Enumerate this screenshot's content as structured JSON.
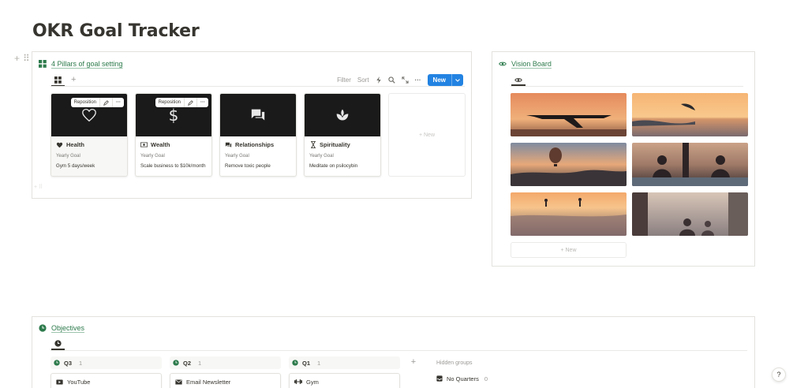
{
  "page": {
    "title": "OKR Goal Tracker"
  },
  "pillars": {
    "title": "4 Pillars of goal setting",
    "toolbar": {
      "filter": "Filter",
      "sort": "Sort",
      "new": "New"
    },
    "cards": [
      {
        "name": "Health",
        "prop_label": "Yearly Goal",
        "value": "Gym 5 days/week",
        "icon": "heart-pulse-icon",
        "cover_icon": "heart-icon"
      },
      {
        "name": "Wealth",
        "prop_label": "Yearly Goal",
        "value": "Scale business to $10k/month",
        "icon": "money-icon",
        "cover_icon": "dollar-icon"
      },
      {
        "name": "Relationships",
        "prop_label": "Yearly Goal",
        "value": "Remove toxic people",
        "icon": "chat-bubbles-icon",
        "cover_icon": "chat-icon"
      },
      {
        "name": "Spirituality",
        "prop_label": "Yearly Goal",
        "value": "Meditate on psilocybin",
        "icon": "hourglass-icon",
        "cover_icon": "lotus-icon"
      }
    ],
    "hover_tools": {
      "reposition": "Reposition"
    },
    "new_card": "+ New"
  },
  "vision": {
    "title": "Vision Board",
    "new_card": "+ New",
    "photos": [
      "airplane-sunset",
      "dolphin-jump",
      "hot-air-balloon",
      "meditation-pool",
      "sea-sunset-swimmers",
      "balcony-view"
    ]
  },
  "objectives": {
    "title": "Objectives",
    "columns": [
      {
        "name": "Q3",
        "count": "1",
        "card": "YouTube",
        "card_icon": "video-icon"
      },
      {
        "name": "Q2",
        "count": "1",
        "card": "Email Newsletter",
        "card_icon": "mail-icon"
      },
      {
        "name": "Q1",
        "count": "1",
        "card": "Gym",
        "card_icon": "dumbbell-icon"
      }
    ],
    "hidden_groups": {
      "title": "Hidden groups",
      "item": "No Quarters",
      "count": "0"
    }
  },
  "help": {
    "label": "?"
  },
  "colors": {
    "accent_green": "#2c7a4b",
    "primary_blue": "#2383e2",
    "text": "#37352f",
    "muted": "#9b9a97"
  }
}
